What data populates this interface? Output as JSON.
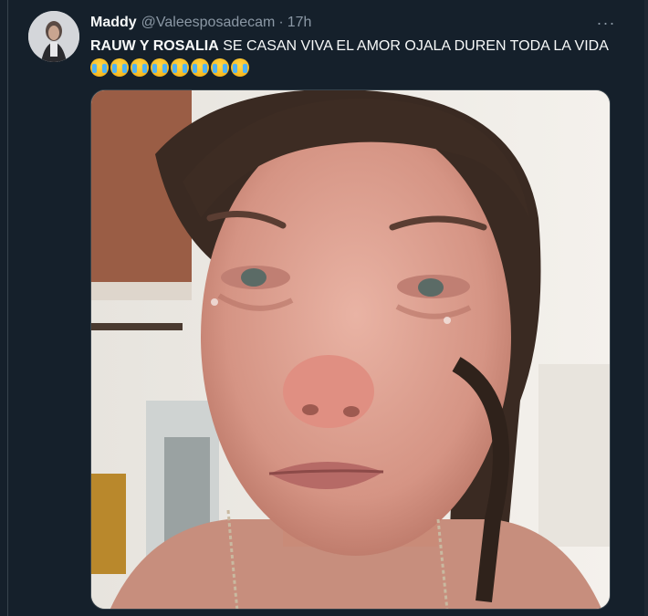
{
  "tweet": {
    "display_name": "Maddy",
    "handle": "@Valeesposadecam",
    "separator": "·",
    "time": "17h",
    "more_label": "···",
    "text_bold": "RAUW Y ROSALIA",
    "text_rest": " SE CASAN VIVA EL AMOR OJALA DUREN TODA LA VIDA",
    "emoji_count": 8,
    "emoji": "loudly-crying-face-emoji"
  },
  "colors": {
    "background": "#15202b",
    "border": "#38444d",
    "secondary_text": "#8b98a5"
  },
  "icons": [
    "more-options-icon",
    "avatar-image",
    "tweet-photo"
  ]
}
